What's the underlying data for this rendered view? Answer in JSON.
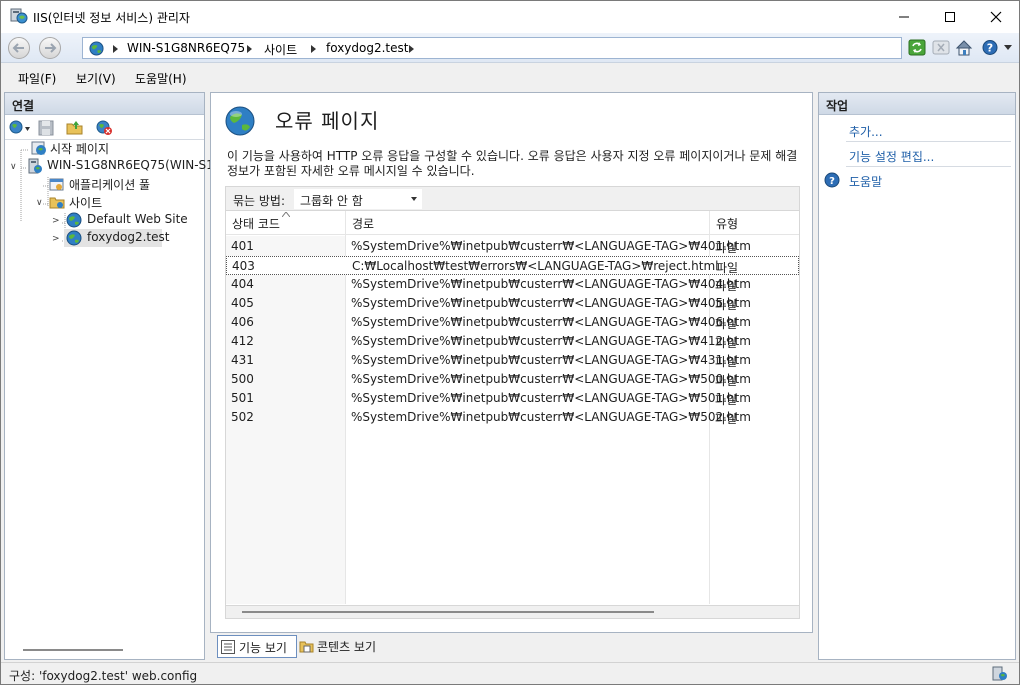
{
  "window": {
    "title": "IIS(인터넷 정보 서비스) 관리자",
    "minimize_icon": "minimize-icon",
    "maximize_icon": "maximize-icon",
    "close_icon": "close-icon"
  },
  "navbar": {
    "breadcrumbs": [
      "WIN-S1G8NR6EQ75",
      "사이트",
      "foxydog2.test"
    ],
    "icons": [
      "back-arrow-icon",
      "forward-arrow-icon",
      "refresh-icon",
      "stop-icon",
      "home-icon",
      "help-icon"
    ]
  },
  "menu": {
    "items": [
      "파일(F)",
      "보기(V)",
      "도움말(H)"
    ]
  },
  "connections": {
    "header": "연결",
    "tree": [
      {
        "label": "시작 페이지",
        "icon": "start-page-icon"
      },
      {
        "label": "WIN-S1G8NR6EQ75(WIN-S1",
        "icon": "server-icon"
      },
      {
        "label": "애플리케이션 풀",
        "icon": "app-pool-icon"
      },
      {
        "label": "사이트",
        "icon": "sites-folder-icon"
      },
      {
        "label": "Default Web Site",
        "icon": "globe-icon"
      },
      {
        "label": "foxydog2.test",
        "icon": "globe-icon"
      }
    ]
  },
  "content": {
    "title": "오류 페이지",
    "description": "이 기능을 사용하여 HTTP 오류 응답을 구성할 수 있습니다. 오류 응답은 사용자 지정 오류 페이지이거나 문제 해결 정보가 포함된 자세한 오류 메시지일 수 있습니다.",
    "group_by_label": "묶는 방법:",
    "group_by_value": "그룹화 안 함",
    "columns": [
      "상태 코드",
      "경로",
      "유형"
    ],
    "rows": [
      {
        "code": "401",
        "path": "%SystemDrive%₩inetpub₩custerr₩<LANGUAGE-TAG>₩401.htm",
        "type": "파일"
      },
      {
        "code": "403",
        "path": "C:₩Localhost₩test₩errors₩<LANGUAGE-TAG>₩reject.html",
        "type": "파일"
      },
      {
        "code": "404",
        "path": "%SystemDrive%₩inetpub₩custerr₩<LANGUAGE-TAG>₩404.htm",
        "type": "파일"
      },
      {
        "code": "405",
        "path": "%SystemDrive%₩inetpub₩custerr₩<LANGUAGE-TAG>₩405.htm",
        "type": "파일"
      },
      {
        "code": "406",
        "path": "%SystemDrive%₩inetpub₩custerr₩<LANGUAGE-TAG>₩406.htm",
        "type": "파일"
      },
      {
        "code": "412",
        "path": "%SystemDrive%₩inetpub₩custerr₩<LANGUAGE-TAG>₩412.htm",
        "type": "파일"
      },
      {
        "code": "431",
        "path": "%SystemDrive%₩inetpub₩custerr₩<LANGUAGE-TAG>₩431.htm",
        "type": "파일"
      },
      {
        "code": "500",
        "path": "%SystemDrive%₩inetpub₩custerr₩<LANGUAGE-TAG>₩500.htm",
        "type": "파일"
      },
      {
        "code": "501",
        "path": "%SystemDrive%₩inetpub₩custerr₩<LANGUAGE-TAG>₩501.htm",
        "type": "파일"
      },
      {
        "code": "502",
        "path": "%SystemDrive%₩inetpub₩custerr₩<LANGUAGE-TAG>₩502.htm",
        "type": "파일"
      }
    ]
  },
  "view_tabs": {
    "features_view": "기능 보기",
    "content_view": "콘텐츠 보기"
  },
  "actions": {
    "header": "작업",
    "add": "추가...",
    "edit_feature_settings": "기능 설정 편집...",
    "help": "도움말"
  },
  "status": {
    "text": "구성: 'foxydog2.test' web.config"
  },
  "colors": {
    "link": "#1f5fa8",
    "panel_border": "#a7b3c2"
  }
}
